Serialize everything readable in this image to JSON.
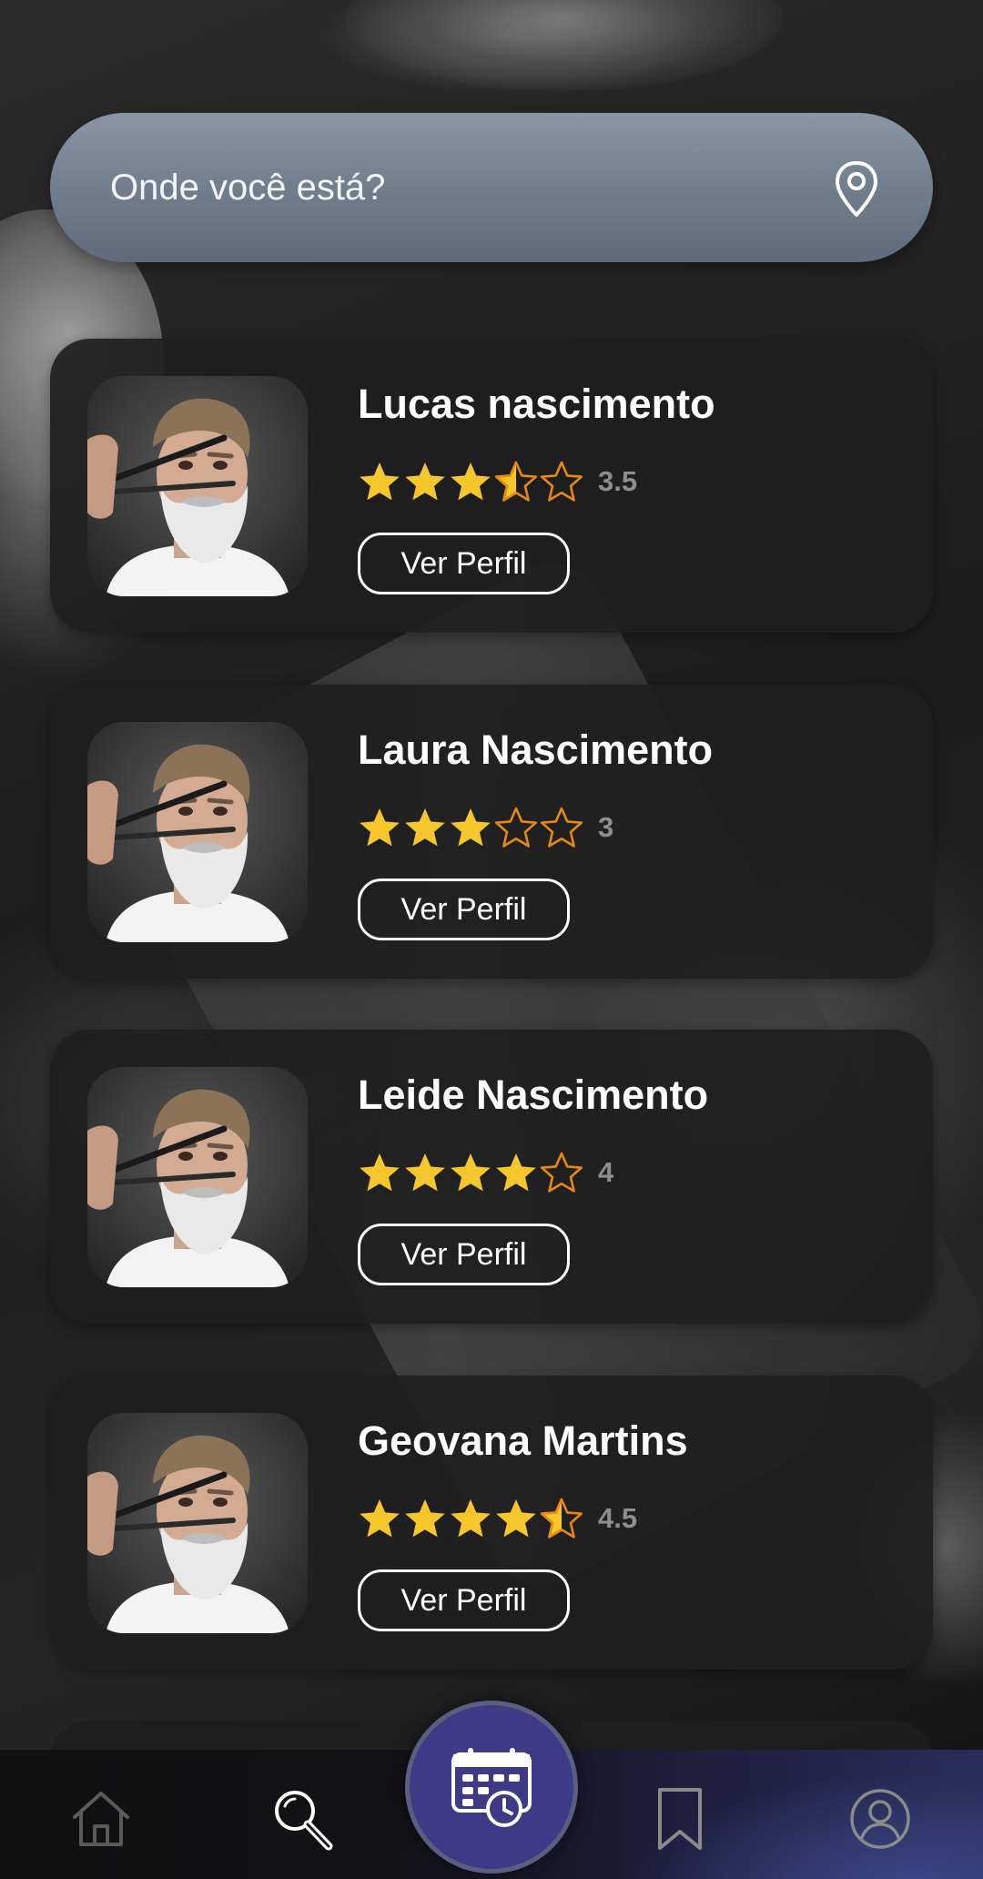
{
  "search": {
    "placeholder": "Onde você está?",
    "value": "",
    "icon": "map-pin-icon"
  },
  "barbers": [
    {
      "name": "Lucas nascimento",
      "rating": 3.5,
      "rating_label": "3.5",
      "button_label": "Ver Perfil"
    },
    {
      "name": "Laura Nascimento",
      "rating": 3,
      "rating_label": "3",
      "button_label": "Ver Perfil"
    },
    {
      "name": "Leide Nascimento",
      "rating": 4,
      "rating_label": "4",
      "button_label": "Ver Perfil"
    },
    {
      "name": "Geovana Martins",
      "rating": 4.5,
      "rating_label": "4.5",
      "button_label": "Ver Perfil"
    }
  ],
  "nav": {
    "items": [
      {
        "icon": "home-icon",
        "active": false
      },
      {
        "icon": "search-icon",
        "active": true
      },
      {
        "icon": "calendar-clock-icon",
        "active": false,
        "center": true
      },
      {
        "icon": "bookmark-icon",
        "active": false
      },
      {
        "icon": "user-circle-icon",
        "active": false
      }
    ]
  },
  "colors": {
    "star_filled": "#F5C72C",
    "star_outline": "#E8880E",
    "card_bg": "#1E1E1E",
    "search_bar": "#7A8798",
    "center_button": "#3F3A86",
    "rating_text": "#8E8E8E"
  }
}
